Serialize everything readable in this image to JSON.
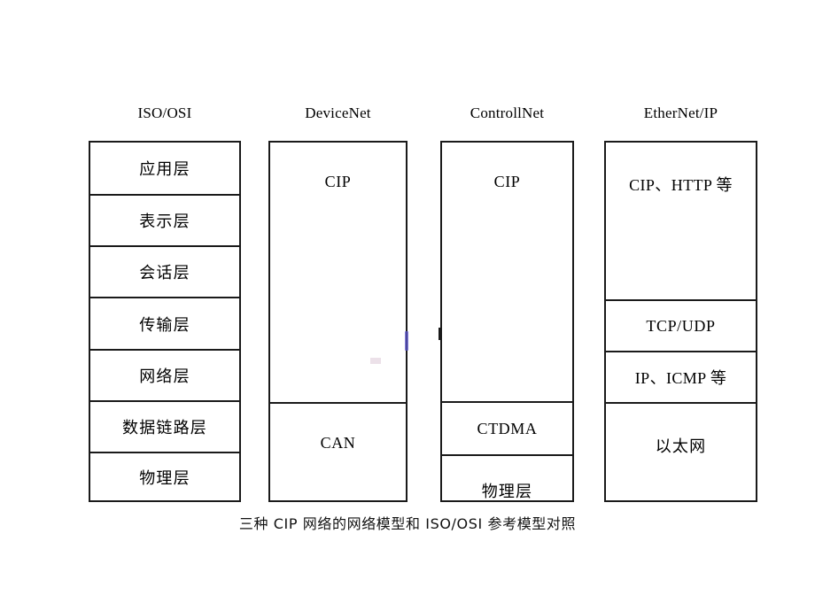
{
  "diagram": {
    "caption": "三种 CIP 网络的网络模型和 ISO/OSI 参考模型对照",
    "columns": [
      {
        "id": "iso-osi",
        "header": "ISO/OSI",
        "cells": [
          {
            "label": "应用层",
            "script": "cjk"
          },
          {
            "label": "表示层",
            "script": "cjk"
          },
          {
            "label": "会话层",
            "script": "cjk"
          },
          {
            "label": "传输层",
            "script": "cjk"
          },
          {
            "label": "网络层",
            "script": "cjk"
          },
          {
            "label": "数据链路层",
            "script": "cjk"
          },
          {
            "label": "物理层",
            "script": "cjk"
          }
        ]
      },
      {
        "id": "devicenet",
        "header": "DeviceNet",
        "cells": [
          {
            "label": "CIP",
            "script": "latin"
          },
          {
            "label": "CAN",
            "script": "latin"
          }
        ]
      },
      {
        "id": "controlnet",
        "header": "ControllNet",
        "cells": [
          {
            "label": "CIP",
            "script": "latin"
          },
          {
            "label": "CTDMA",
            "script": "latin"
          },
          {
            "label": "物理层",
            "script": "cjk"
          }
        ]
      },
      {
        "id": "ethernet-ip",
        "header": "EtherNet/IP",
        "cells": [
          {
            "label": "CIP、HTTP 等",
            "script": "mixed"
          },
          {
            "label": "TCP/UDP",
            "script": "latin"
          },
          {
            "label": "IP、ICMP 等",
            "script": "mixed"
          },
          {
            "label": "以太网",
            "script": "cjk"
          }
        ]
      }
    ],
    "colors": {
      "background": "#ffffff",
      "border": "#1a1a1a",
      "text": "#000000",
      "artifact": "#5b54c8"
    }
  }
}
